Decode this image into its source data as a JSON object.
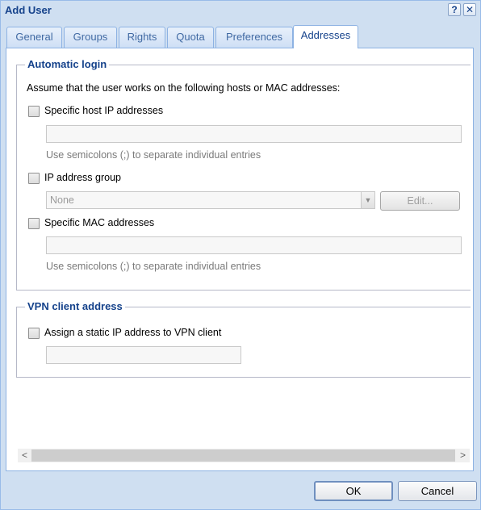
{
  "window": {
    "title": "Add User",
    "help_icon": "help-icon",
    "close_icon": "close-icon",
    "help_glyph": "?",
    "close_glyph": "✕"
  },
  "tabs": [
    {
      "label": "General"
    },
    {
      "label": "Groups"
    },
    {
      "label": "Rights"
    },
    {
      "label": "Quota"
    },
    {
      "label": "Preferences"
    },
    {
      "label": "Addresses",
      "active": true
    }
  ],
  "automatic_login": {
    "legend": "Automatic login",
    "description": "Assume that the user works on the following hosts or MAC addresses:",
    "specific_host": {
      "label": "Specific host IP addresses",
      "checked": false,
      "value": "",
      "hint": "Use semicolons (;) to separate individual entries"
    },
    "ip_group": {
      "label": "IP address group",
      "checked": false,
      "selected": "None",
      "edit_label": "Edit..."
    },
    "specific_mac": {
      "label": "Specific MAC addresses",
      "checked": false,
      "value": "",
      "hint": "Use semicolons (;) to separate individual entries"
    }
  },
  "vpn": {
    "legend": "VPN client address",
    "assign_label": "Assign a static IP address to VPN client",
    "checked": false,
    "value": ""
  },
  "scrollbar": {
    "left_glyph": "<",
    "right_glyph": ">"
  },
  "footer": {
    "ok_label": "OK",
    "cancel_label": "Cancel"
  },
  "colors": {
    "window_bg": "#cfdff1",
    "title_text": "#15428b",
    "tab_border": "#8db2e3"
  }
}
